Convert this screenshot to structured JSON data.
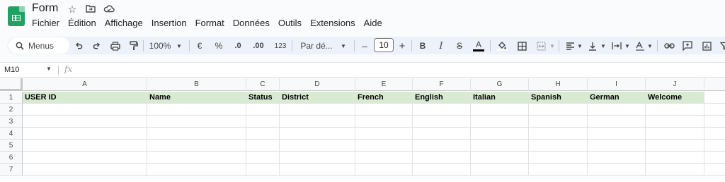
{
  "doc": {
    "title": "Form"
  },
  "title_icons": [
    "star-icon",
    "move-folder-icon",
    "cloud-status-icon"
  ],
  "menu": [
    "Fichier",
    "Édition",
    "Affichage",
    "Insertion",
    "Format",
    "Données",
    "Outils",
    "Extensions",
    "Aide"
  ],
  "toolbar": {
    "search_label": "Menus",
    "zoom": "100%",
    "currency": "€",
    "percent": "%",
    "dec_decrease": ".0",
    "dec_increase": ".00",
    "number_format": "123",
    "font": "Par dé...",
    "font_size": "10",
    "minus": "–",
    "plus": "+",
    "bold": "B",
    "italic": "I",
    "strike": "S",
    "text_color": "A",
    "text_color_swatch": "#000000"
  },
  "formula_bar": {
    "cell_ref": "M10",
    "fx": "fx"
  },
  "sheet": {
    "columns": [
      "A",
      "B",
      "C",
      "D",
      "E",
      "F",
      "G",
      "H",
      "I",
      "J"
    ],
    "rows": [
      "1",
      "2",
      "3",
      "4",
      "5",
      "6",
      "7"
    ],
    "header_row": [
      "USER ID",
      "Name",
      "Status",
      "District",
      "French",
      "English",
      "Italian",
      "Spanish",
      "German",
      "Welcome"
    ],
    "header_fill": "#d9ead3"
  }
}
